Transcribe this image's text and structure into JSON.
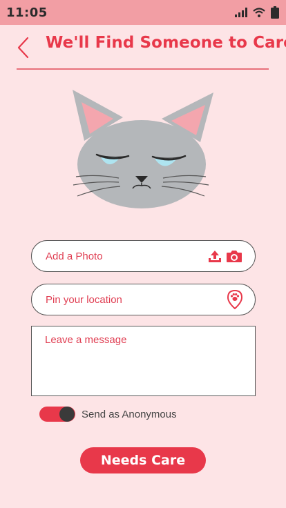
{
  "status_bar": {
    "time": "11:05"
  },
  "header": {
    "title": "We'll Find Someone to Care"
  },
  "form": {
    "photo_label": "Add a Photo",
    "location_label": "Pin your location",
    "message_placeholder": "Leave a message",
    "anonymous_label": "Send as Anonymous",
    "anonymous_enabled": true,
    "submit_label": "Needs Care"
  },
  "colors": {
    "accent": "#e8384a",
    "background": "#fde4e6",
    "status_bar": "#f29ea4",
    "cat_fur": "#b4b7ba"
  },
  "icons": {
    "back": "chevron-left-icon",
    "photo_actions": [
      "upload-icon",
      "camera-icon"
    ],
    "location": "map-pin-paw-icon"
  }
}
